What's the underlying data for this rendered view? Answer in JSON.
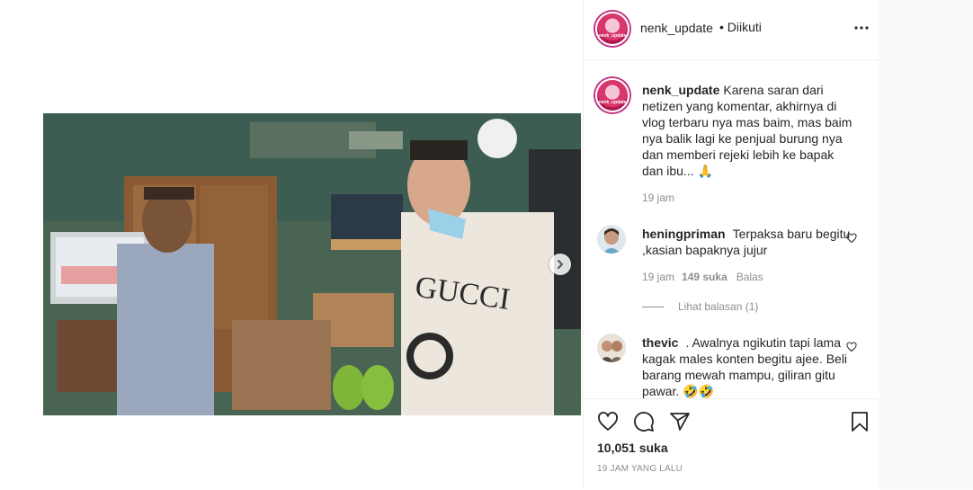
{
  "post": {
    "author": "nenk_update",
    "follow_status": "• Diikuti",
    "avatar_text": "nenk_update",
    "caption": "Karena saran dari netizen yang komentar, akhirnya di vlog terbaru nya mas baim, mas baim nya balik lagi ke penjual burung nya dan memberi rejeki lebih ke bapak dan ibu... 🙏",
    "caption_time": "19 jam",
    "media_overlay_text": "GUCCI"
  },
  "comments": [
    {
      "username": "heningpriman",
      "text": "Terpaksa baru begitu ,kasian bapaknya jujur",
      "time": "19 jam",
      "likes": "149 suka",
      "reply_label": "Balas",
      "view_replies": "Lihat balasan (1)"
    },
    {
      "username": "thevic",
      "text": ". Awalnya ngikutin tapi lama kagak males konten begitu ajee. Beli barang mewah mampu, giliran gitu pawar. 🤣🤣"
    }
  ],
  "footer": {
    "likes": "10,051 suka",
    "time_ago": "19 JAM YANG LALU"
  },
  "icons": {
    "more": "more-icon",
    "heart": "heart-icon",
    "comment": "comment-icon",
    "share": "share-icon",
    "save": "bookmark-icon",
    "next": "chevron-right-icon"
  },
  "colors": {
    "text": "#262626",
    "muted": "#8e8e8e",
    "border": "#efefef",
    "avatar_ring": "#c13584"
  }
}
